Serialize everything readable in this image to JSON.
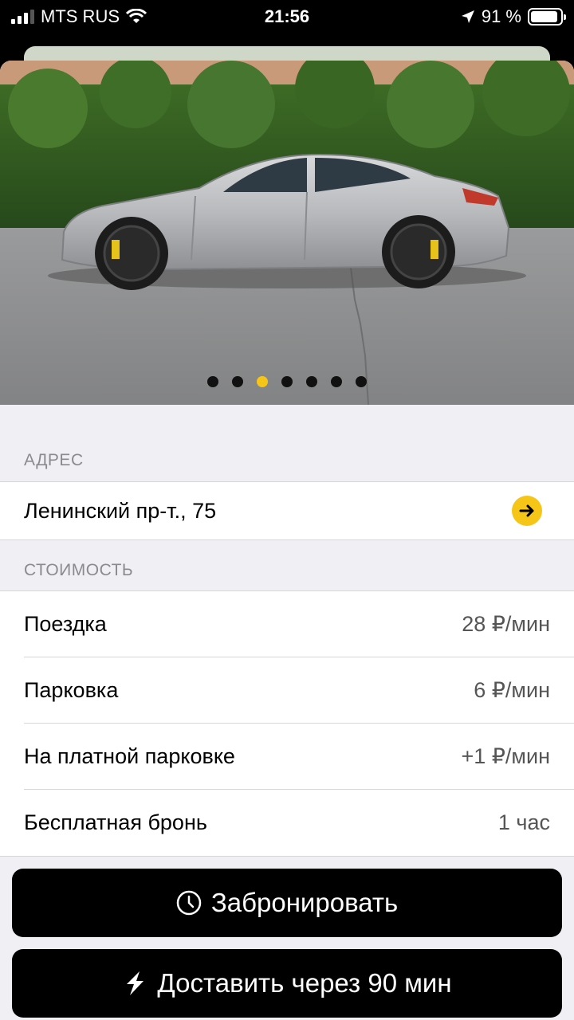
{
  "status_bar": {
    "carrier": "MTS RUS",
    "time": "21:56",
    "battery_percent": "91 %",
    "battery_level": 0.91
  },
  "gallery": {
    "photo_count": 7,
    "active_index": 2,
    "active_color": "#f5c518"
  },
  "address_section": {
    "header": "АДРЕС",
    "address": "Ленинский пр-т., 75",
    "action_icon": "arrow-right-icon"
  },
  "price_section": {
    "header": "СТОИМОСТЬ",
    "rows": [
      {
        "label": "Поездка",
        "value": "28 ₽/мин"
      },
      {
        "label": "Парковка",
        "value": "6 ₽/мин"
      },
      {
        "label": "На платной парковке",
        "value": "+1 ₽/мин"
      },
      {
        "label": "Бесплатная бронь",
        "value": "1 час"
      }
    ]
  },
  "actions": {
    "book_label": "Забронировать",
    "book_icon": "clock-icon",
    "deliver_label": "Доставить через 90 мин",
    "deliver_icon": "lightning-icon"
  }
}
